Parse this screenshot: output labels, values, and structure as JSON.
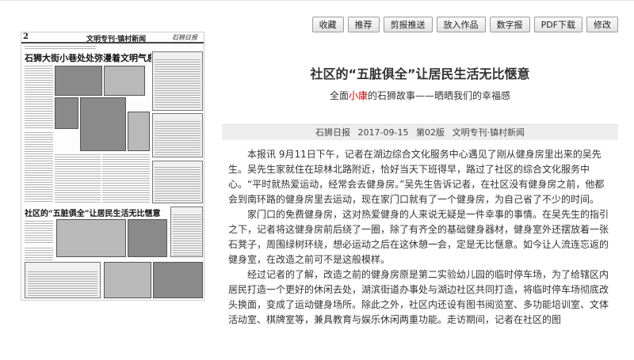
{
  "toolbar": {
    "buttons": [
      "收藏",
      "推荐",
      "剪报推送",
      "放入作品",
      "数字报",
      "PDF下载",
      "修改"
    ]
  },
  "paper": {
    "page_number": "2",
    "section": "文明专刊·镇村新闻",
    "logo": "石狮日报",
    "headline_top": "石狮大街小巷处处弥漫着文明气息",
    "headline_mid": "社区的“五脏俱全”让居民生活无比惬意"
  },
  "article": {
    "title": "社区的“五脏俱全”让居民生活无比惬意",
    "subtitle_pre": "全面",
    "subtitle_highlight": "小康",
    "subtitle_post": "的石狮故事——晒晒我们的幸福感",
    "meta": {
      "source": "石狮日报",
      "date": "2017-09-15",
      "page": "第02版",
      "section": "文明专刊·镇村新闻"
    },
    "paragraphs": [
      "本报讯 9月11日下午，记者在湖边综合文化服务中心遇见了刚从健身房里出来的吴先生。吴先生家就住在琼林北路附近，恰好当天下班得早，路过了社区的综合文化服务中心。“平时就热爱运动，经常会去健身房。”吴先生告诉记者，在社区没有健身房之前，他都会到南环路的健身房里去运动，现在家门口就有了一个健身房，为自己省了不少的时间。",
      "家门口的免费健身房，这对热爱健身的人来说无疑是一件幸事的事情。在吴先生的指引之下，记者将这健身房前后绕了一圈，除了有齐全的基础健身器材，健身室外还摆放着一张石凳子，周围绿树环绕，想必运动之后在这休憩一会，定是无比惬意。如今让人流连忘返的健身室，在改造之前可不是这般模样。",
      "经过记者的了解，改造之前的健身房原是第二实验幼儿园的临时停车场，为了给辖区内居民打造一个更好的休闲去处，湖滨街道办事处与湖边社区共同打造，将临时停车场彻底改头换面，变成了运动健身场所。除此之外，社区内还设有图书阅览室、多功能培训室、文体活动室、棋牌室等，兼具教育与娱乐休闲两重功能。走访期间，记者在社区的图"
    ]
  }
}
